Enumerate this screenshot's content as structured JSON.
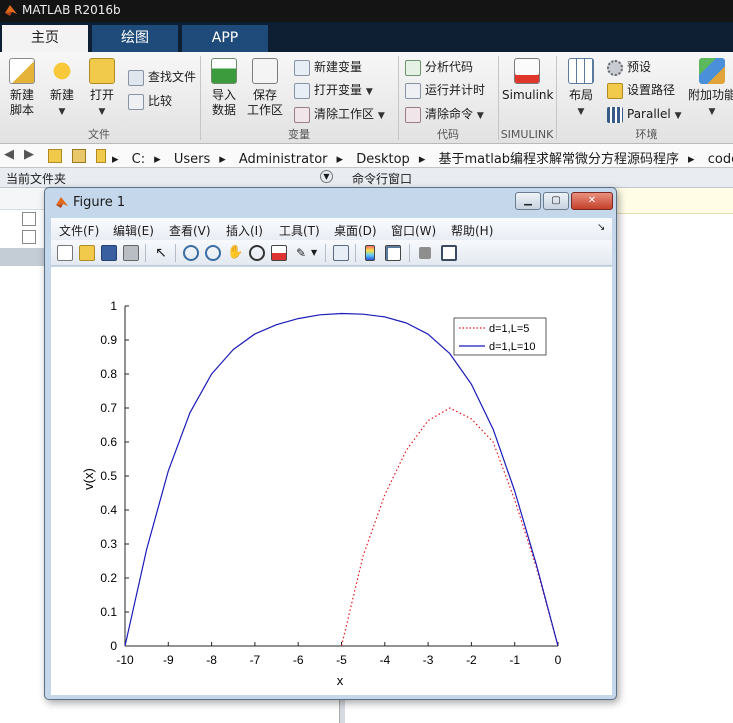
{
  "matlab": {
    "title": "MATLAB R2016b",
    "tabs": [
      "主页",
      "绘图",
      "APP"
    ],
    "ribbon": {
      "file": {
        "new_script": "新建\n脚本",
        "new": "新建",
        "open": "打开",
        "find_files": "查找文件",
        "compare": "比较",
        "section": "文件"
      },
      "variable": {
        "import": "导入\n数据",
        "save_workspace": "保存\n工作区",
        "new_variable": "新建变量",
        "open_variable": "打开变量",
        "clear_workspace": "清除工作区",
        "section": "变量"
      },
      "code": {
        "analyze": "分析代码",
        "run_time": "运行并计时",
        "clear_commands": "清除命令",
        "section": "代码"
      },
      "simulink": {
        "label": "Simulink",
        "section": "SIMULINK"
      },
      "environment": {
        "layout": "布局",
        "preferences": "预设",
        "set_path": "设置路径",
        "parallel": "Parallel",
        "addons": "附加功能",
        "section": "环境"
      }
    },
    "path": [
      "C:",
      "Users",
      "Administrator",
      "Desktop",
      "基于matlab编程求解常微分方程源码程序",
      "code"
    ],
    "current_folder_label": "当前文件夹",
    "command_window_label": "命令行窗口"
  },
  "figure": {
    "title": "Figure 1",
    "menu": [
      "文件(F)",
      "编辑(E)",
      "查看(V)",
      "插入(I)",
      "工具(T)",
      "桌面(D)",
      "窗口(W)",
      "帮助(H)"
    ]
  },
  "colors": {
    "series1": "#e8141c",
    "series2": "#1a1ab8",
    "matlab_tab_blue": "#1f4b7a"
  },
  "chart_data": {
    "type": "line",
    "title": "",
    "xlabel": "x",
    "ylabel": "v(x)",
    "xlim": [
      -10,
      0
    ],
    "ylim": [
      0,
      1
    ],
    "xticks": [
      -10,
      -9,
      -8,
      -7,
      -6,
      -5,
      -4,
      -3,
      -2,
      -1,
      0
    ],
    "yticks": [
      0,
      0.1,
      0.2,
      0.3,
      0.4,
      0.5,
      0.6,
      0.7,
      0.8,
      0.9,
      1
    ],
    "grid": false,
    "legend_position": "top-right",
    "series": [
      {
        "name": "d=1,L=5",
        "style": "dotted",
        "color": "#e8141c",
        "x": [
          -5,
          -4.5,
          -4,
          -3.5,
          -3,
          -2.5,
          -2,
          -1.5,
          -1,
          -0.5,
          0
        ],
        "y": [
          0,
          0.265,
          0.445,
          0.576,
          0.663,
          0.7,
          0.668,
          0.6,
          0.43,
          0.232,
          0
        ]
      },
      {
        "name": "d=1,L=10",
        "style": "solid",
        "color": "#1a1ab8",
        "x": [
          -10,
          -9.5,
          -9,
          -8.5,
          -8,
          -7.5,
          -7,
          -6.5,
          -6,
          -5.5,
          -5,
          -4.5,
          -4,
          -3.5,
          -3,
          -2.5,
          -2,
          -1.5,
          -1,
          -0.5,
          0
        ],
        "y": [
          0,
          0.285,
          0.515,
          0.686,
          0.8,
          0.872,
          0.918,
          0.945,
          0.963,
          0.974,
          0.978,
          0.976,
          0.968,
          0.95,
          0.917,
          0.86,
          0.77,
          0.638,
          0.456,
          0.24,
          0
        ]
      }
    ]
  }
}
